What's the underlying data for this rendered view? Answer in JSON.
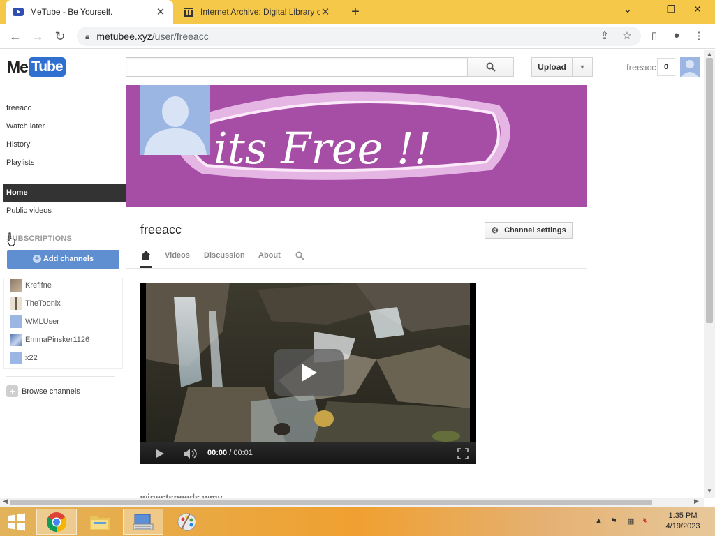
{
  "browser": {
    "tabs": [
      {
        "title": "MeTube - Be Yourself."
      },
      {
        "title": "Internet Archive: Digital Library o"
      }
    ],
    "url_host": "metubee.xyz",
    "url_path": "/user/freeacc"
  },
  "header": {
    "logo_me": "Me",
    "logo_tube": "Tube",
    "search_value": "",
    "upload_label": "Upload",
    "username": "freeacc",
    "notification_count": "0"
  },
  "sidebar": {
    "user_links": [
      "freeacc",
      "Watch later",
      "History",
      "Playlists"
    ],
    "home_label": "Home",
    "public_videos_label": "Public videos",
    "subscriptions_header": "SUBSCRIPTIONS",
    "add_channels_label": "Add channels",
    "subscriptions": [
      "Krefifne",
      "TheToonix",
      "WMLUser",
      "EmmaPinsker1126",
      "x22"
    ],
    "browse_channels_label": "Browse channels"
  },
  "channel": {
    "banner_text": "its Free !!",
    "name": "freeacc",
    "settings_label": "Channel settings",
    "tabs": [
      "Videos",
      "Discussion",
      "About"
    ]
  },
  "video": {
    "current_time": "00:00",
    "separator": "/",
    "duration": "00:01",
    "caption": "winestspeeds.wmv"
  },
  "taskbar": {
    "time": "1:35 PM",
    "date": "4/19/2023"
  },
  "colors": {
    "banner": "#a64ea6",
    "accent_blue": "#2f6fd0",
    "add_channels_button": "#5f8fd0",
    "home_active": "#333333",
    "chrome_tabbar": "#f6c84a"
  }
}
